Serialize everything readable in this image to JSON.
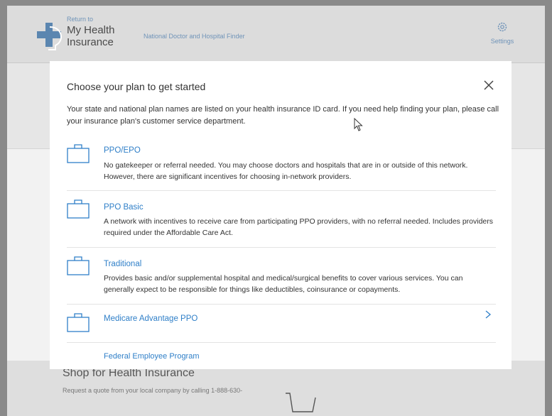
{
  "header": {
    "return_to": "Return to",
    "app_name_line1": "My Health",
    "app_name_line2": "Insurance",
    "finder_link": "National Doctor and Hospital Finder",
    "settings_label": "Settings"
  },
  "background": {
    "shop_title": "Shop for Health Insurance",
    "shop_text": "Request a quote from your local     company by calling 1-888-630-"
  },
  "modal": {
    "title": "Choose your plan to get started",
    "intro": "Your state and national plan names are listed on your health insurance ID card. If you need help finding your plan, please call your insurance plan's customer service department.",
    "plans": [
      {
        "name": "PPO/EPO",
        "description": "No gatekeeper or referral needed. You may choose doctors and hospitals that are in or outside of this network. However, there are significant incentives for choosing in-network providers."
      },
      {
        "name": "PPO Basic",
        "description": "A network with incentives to receive care from participating PPO providers, with no referral needed. Includes providers required under the Affordable Care Act."
      },
      {
        "name": "Traditional",
        "description": "Provides basic and/or supplemental hospital and medical/surgical benefits to cover various services. You can generally expect to be responsible for things like deductibles, coinsurance or copayments."
      },
      {
        "name": "Medicare Advantage PPO",
        "description": ""
      },
      {
        "name": "Federal Employee Program",
        "description": ""
      }
    ]
  },
  "icons": {
    "plan": "briefcase-icon",
    "close": "close-icon",
    "settings": "gear-icon",
    "chevron": "chevron-right-icon"
  },
  "colors": {
    "link": "#2f7fc8",
    "text": "#333333",
    "overlay": "#8a8a8a"
  }
}
